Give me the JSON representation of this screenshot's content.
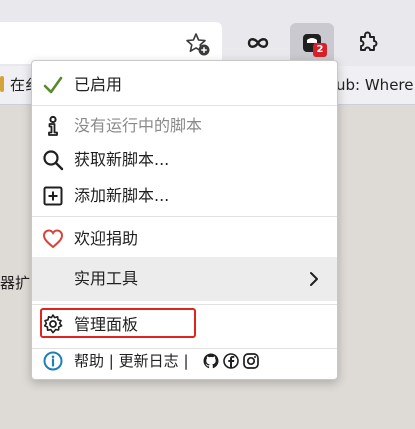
{
  "browser": {
    "bookmarks_left": "在纟",
    "bookmarks_right": "ub: Where t",
    "page_text": "器扩",
    "extension_badge": "2",
    "icons": [
      "bookmark-star-icon",
      "infinity-icon",
      "extension-icon",
      "puzzle-icon"
    ]
  },
  "menu": {
    "enabled_label": "已启用",
    "no_scripts_label": "没有运行中的脚本",
    "get_scripts_label": "获取新脚本...",
    "add_script_label": "添加新脚本...",
    "donate_label": "欢迎捐助",
    "utilities_label": "实用工具",
    "dashboard_label": "管理面板",
    "help_label": "帮助",
    "sep1": "|",
    "changelog_label": "更新日志",
    "sep2": "|"
  },
  "colors": {
    "check": "#5a8a2b",
    "heart": "#d8443a",
    "info": "#1e7fb6",
    "highlight": "#e0231d"
  }
}
